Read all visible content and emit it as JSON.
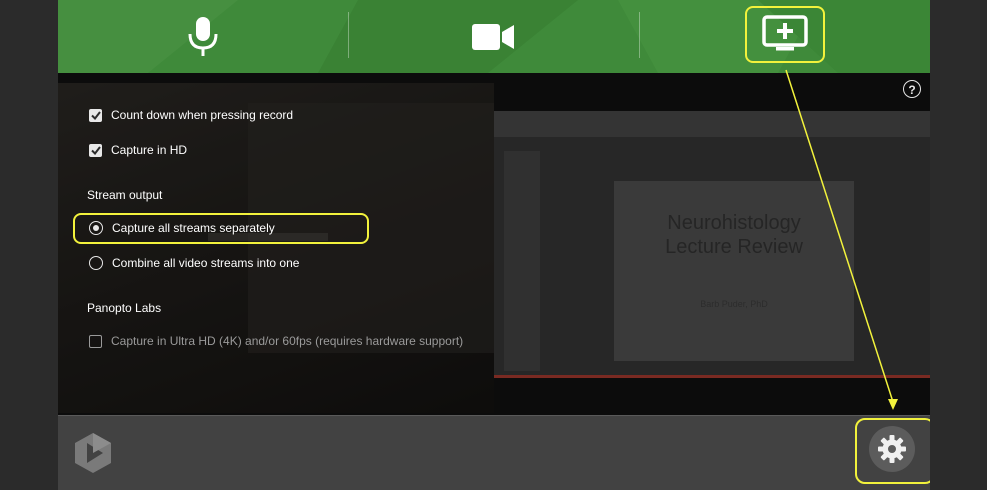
{
  "toolbar": {
    "sources": [
      {
        "name": "audio",
        "icon": "microphone-icon"
      },
      {
        "name": "video",
        "icon": "video-camera-icon"
      },
      {
        "name": "add-screen",
        "icon": "add-screen-icon"
      }
    ]
  },
  "settings": {
    "countdown_label": "Count down when pressing record",
    "countdown_checked": true,
    "capture_hd_label": "Capture in HD",
    "capture_hd_checked": true,
    "stream_output_heading": "Stream output",
    "stream_options": [
      {
        "label": "Capture all streams separately",
        "selected": true
      },
      {
        "label": "Combine all video streams into one",
        "selected": false
      }
    ],
    "labs_heading": "Panopto Labs",
    "ultra_hd_label": "Capture in Ultra HD (4K) and/or 60fps (requires hardware support)",
    "ultra_hd_checked": false
  },
  "preview": {
    "slide_title": "Neurohistology Lecture Review",
    "slide_author": "Barb Puder, PhD"
  },
  "help": {
    "icon": "help-icon",
    "label": "?"
  },
  "footer": {
    "logo": "panopto-logo-icon",
    "settings_icon": "gear-icon"
  },
  "colors": {
    "toolbar_green": "#3f8a3a",
    "highlight_yellow": "#f2f23c",
    "background": "#2b2b2b"
  }
}
